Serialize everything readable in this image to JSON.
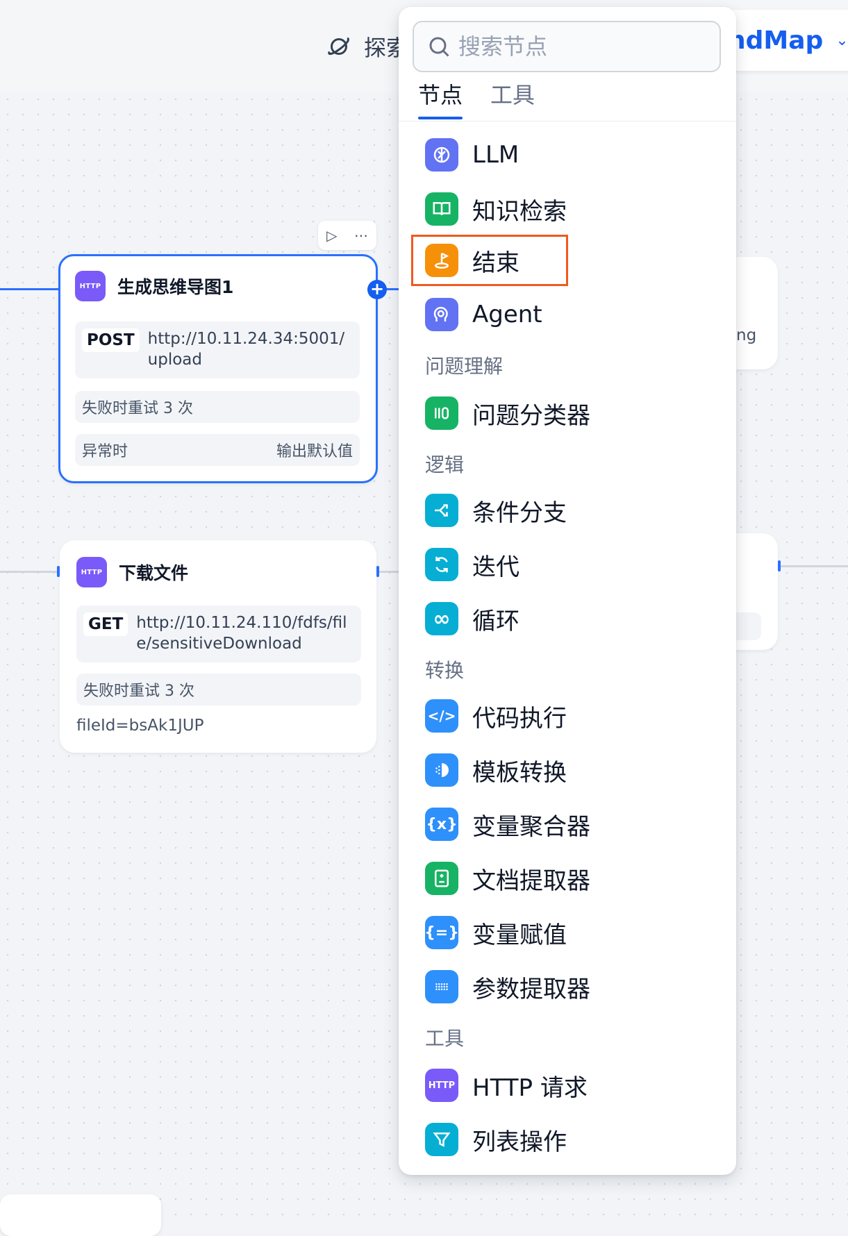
{
  "topbar": {
    "explore_label": "探索",
    "app_name": "ndMap",
    "chevron": "chevron-down-icon"
  },
  "nodes": [
    {
      "title": "生成思维导图1",
      "badge": "HTTP",
      "method": "POST",
      "url": "http://10.11.24.34:5001/upload",
      "retry": "失败时重试 3 次",
      "error_label": "异常时",
      "error_value": "输出默认值"
    },
    {
      "title": "下载文件",
      "badge": "HTTP",
      "method": "GET",
      "url": "http://10.11.24.110/fdfs/file/sensitiveDownload",
      "retry": "失败时重试 3 次",
      "param": "fileId=bsAk1JUP"
    }
  ],
  "partial_node_text": "ng",
  "selector": {
    "search_placeholder": "搜索节点",
    "tabs": [
      {
        "label": "节点",
        "active": true
      },
      {
        "label": "工具",
        "active": false
      }
    ],
    "items": {
      "llm": {
        "label": "LLM",
        "icon": "brain-icon",
        "color": "#6172f3"
      },
      "knowledge": {
        "label": "知识检索",
        "icon": "book-open-icon",
        "color": "#16b364"
      },
      "end": {
        "label": "结束",
        "icon": "flag-end-icon",
        "color": "#f79009"
      },
      "agent": {
        "label": "Agent",
        "icon": "agent-icon",
        "color": "#6172f3"
      },
      "classifier": {
        "label": "问题分类器",
        "icon": "classifier-icon",
        "color": "#16b364"
      },
      "ifelse": {
        "label": "条件分支",
        "icon": "branch-icon",
        "color": "#06aed4"
      },
      "iteration": {
        "label": "迭代",
        "icon": "iteration-icon",
        "color": "#06aed4"
      },
      "loop": {
        "label": "循环",
        "icon": "infinity-icon",
        "color": "#06aed4"
      },
      "code": {
        "label": "代码执行",
        "icon": "code-icon",
        "color": "#2e90fa"
      },
      "template": {
        "label": "模板转换",
        "icon": "template-icon",
        "color": "#2e90fa"
      },
      "aggregator": {
        "label": "变量聚合器",
        "icon": "variable-icon",
        "color": "#2e90fa"
      },
      "docextract": {
        "label": "文档提取器",
        "icon": "document-icon",
        "color": "#16b364"
      },
      "assign": {
        "label": "变量赋值",
        "icon": "assign-icon",
        "color": "#2e90fa"
      },
      "param": {
        "label": "参数提取器",
        "icon": "param-icon",
        "color": "#2e90fa"
      },
      "http": {
        "label": "HTTP 请求",
        "icon": "http-icon",
        "color": "#7a5af8",
        "badge": "HTTP"
      },
      "list": {
        "label": "列表操作",
        "icon": "filter-icon",
        "color": "#06aed4"
      }
    },
    "sections": {
      "understanding": "问题理解",
      "logic": "逻辑",
      "transform": "转换",
      "tools": "工具"
    }
  }
}
